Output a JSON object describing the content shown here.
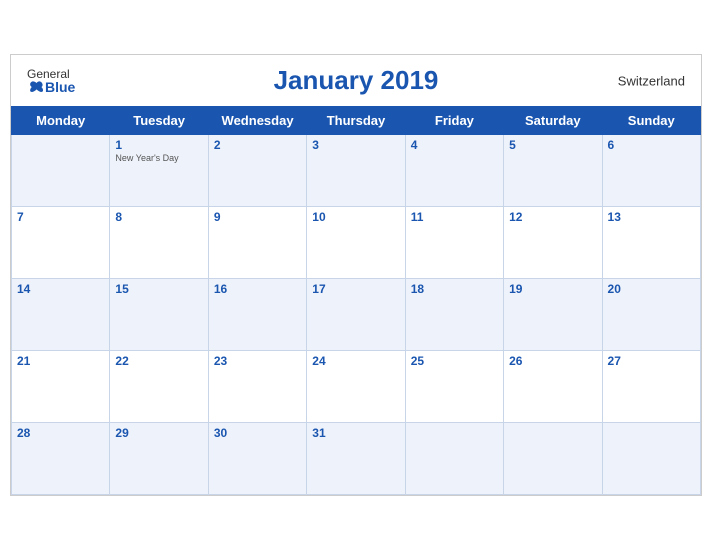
{
  "header": {
    "title": "January 2019",
    "country": "Switzerland",
    "logo_general": "General",
    "logo_blue": "Blue"
  },
  "days_of_week": [
    "Monday",
    "Tuesday",
    "Wednesday",
    "Thursday",
    "Friday",
    "Saturday",
    "Sunday"
  ],
  "weeks": [
    [
      {
        "num": "",
        "holiday": "",
        "empty": true
      },
      {
        "num": "1",
        "holiday": "New Year's Day",
        "empty": false
      },
      {
        "num": "2",
        "holiday": "",
        "empty": false
      },
      {
        "num": "3",
        "holiday": "",
        "empty": false
      },
      {
        "num": "4",
        "holiday": "",
        "empty": false
      },
      {
        "num": "5",
        "holiday": "",
        "empty": false
      },
      {
        "num": "6",
        "holiday": "",
        "empty": false
      }
    ],
    [
      {
        "num": "7",
        "holiday": "",
        "empty": false
      },
      {
        "num": "8",
        "holiday": "",
        "empty": false
      },
      {
        "num": "9",
        "holiday": "",
        "empty": false
      },
      {
        "num": "10",
        "holiday": "",
        "empty": false
      },
      {
        "num": "11",
        "holiday": "",
        "empty": false
      },
      {
        "num": "12",
        "holiday": "",
        "empty": false
      },
      {
        "num": "13",
        "holiday": "",
        "empty": false
      }
    ],
    [
      {
        "num": "14",
        "holiday": "",
        "empty": false
      },
      {
        "num": "15",
        "holiday": "",
        "empty": false
      },
      {
        "num": "16",
        "holiday": "",
        "empty": false
      },
      {
        "num": "17",
        "holiday": "",
        "empty": false
      },
      {
        "num": "18",
        "holiday": "",
        "empty": false
      },
      {
        "num": "19",
        "holiday": "",
        "empty": false
      },
      {
        "num": "20",
        "holiday": "",
        "empty": false
      }
    ],
    [
      {
        "num": "21",
        "holiday": "",
        "empty": false
      },
      {
        "num": "22",
        "holiday": "",
        "empty": false
      },
      {
        "num": "23",
        "holiday": "",
        "empty": false
      },
      {
        "num": "24",
        "holiday": "",
        "empty": false
      },
      {
        "num": "25",
        "holiday": "",
        "empty": false
      },
      {
        "num": "26",
        "holiday": "",
        "empty": false
      },
      {
        "num": "27",
        "holiday": "",
        "empty": false
      }
    ],
    [
      {
        "num": "28",
        "holiday": "",
        "empty": false
      },
      {
        "num": "29",
        "holiday": "",
        "empty": false
      },
      {
        "num": "30",
        "holiday": "",
        "empty": false
      },
      {
        "num": "31",
        "holiday": "",
        "empty": false
      },
      {
        "num": "",
        "holiday": "",
        "empty": true
      },
      {
        "num": "",
        "holiday": "",
        "empty": true
      },
      {
        "num": "",
        "holiday": "",
        "empty": true
      }
    ]
  ]
}
